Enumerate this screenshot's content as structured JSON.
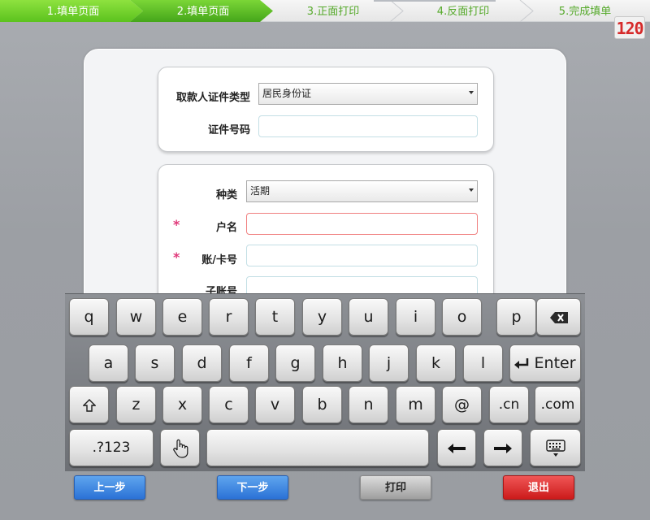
{
  "steps": [
    {
      "label": "1.填单页面",
      "state": "done"
    },
    {
      "label": "2.填单页面",
      "state": "current"
    },
    {
      "label": "3.正面打印",
      "state": "pending"
    },
    {
      "label": "4.反面打印",
      "state": "pending"
    },
    {
      "label": "5.完成填单",
      "state": "pending"
    }
  ],
  "timer": "120",
  "form": {
    "id_type_label": "取款人证件类型",
    "id_type_value": "居民身份证",
    "id_number_label": "证件号码",
    "id_number_value": "",
    "type_label": "种类",
    "type_value": "活期",
    "required_mark": "*",
    "account_name_label": "户名",
    "account_name_value": "",
    "account_no_label": "账/卡号",
    "account_no_value": "",
    "sub_account_label": "子账号",
    "sub_account_value": ""
  },
  "keyboard": {
    "row1": [
      "q",
      "w",
      "e",
      "r",
      "t",
      "y",
      "u",
      "i",
      "o",
      "p"
    ],
    "row2": [
      "a",
      "s",
      "d",
      "f",
      "g",
      "h",
      "j",
      "k",
      "l"
    ],
    "row3": [
      "z",
      "x",
      "c",
      "v",
      "b",
      "n",
      "m",
      "@",
      ".cn",
      ".com"
    ],
    "enter": "Enter",
    "numbers": ".?123"
  },
  "buttons": {
    "prev": "上一步",
    "next": "下一步",
    "print": "打印",
    "exit": "退出"
  },
  "colors": {
    "step_done": "#6fd02c",
    "step_current": "#4fb52a",
    "required": "#e0397a",
    "primary": "#2b72d6",
    "danger": "#cc1b1b"
  }
}
